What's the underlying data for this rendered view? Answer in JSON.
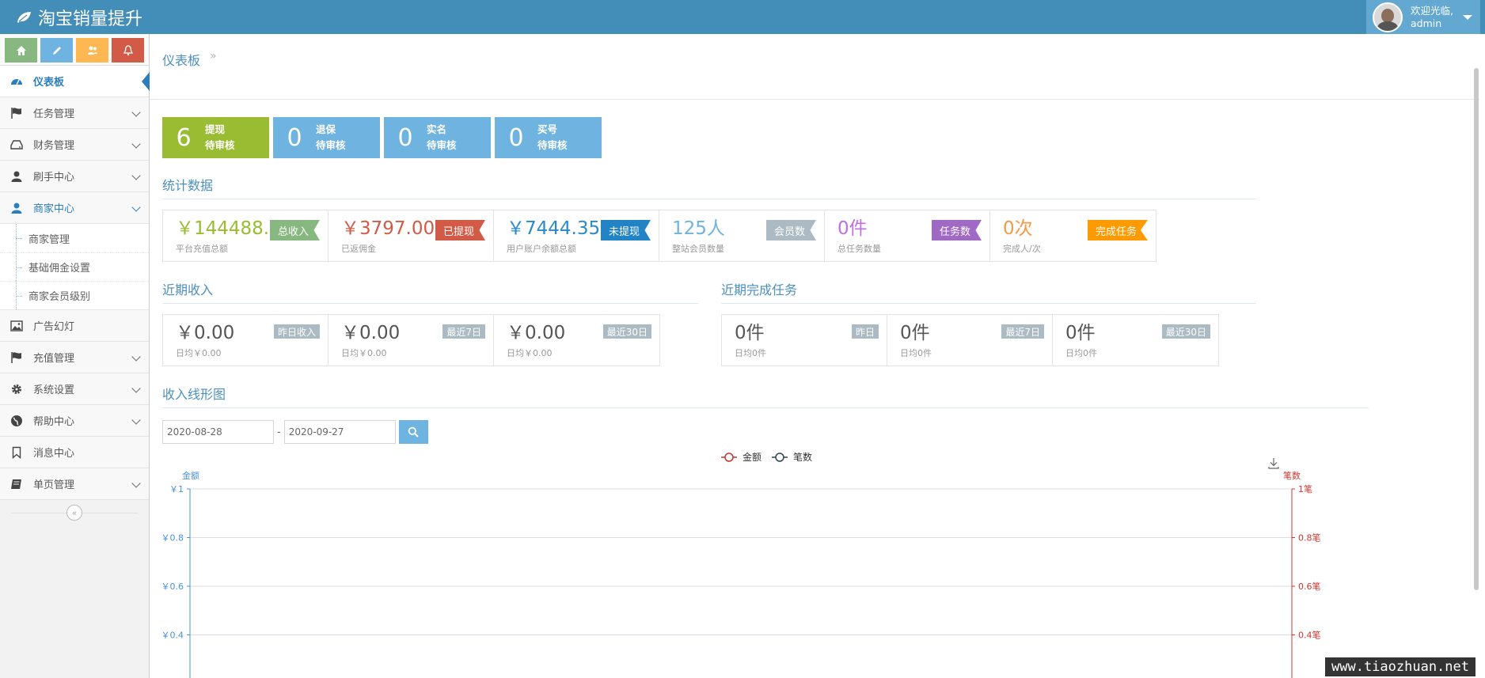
{
  "brand": {
    "title": "淘宝销量提升"
  },
  "user": {
    "welcome": "欢迎光临,",
    "name": "admin"
  },
  "shortcuts": [
    {
      "icon": "home-icon",
      "color": "#87b87f"
    },
    {
      "icon": "pencil-icon",
      "color": "#6fb3e0"
    },
    {
      "icon": "users-icon",
      "color": "#ffb752"
    },
    {
      "icon": "bell-icon",
      "color": "#d15b47"
    }
  ],
  "sidebar": {
    "items": [
      {
        "label": "仪表板",
        "icon": "dashboard-icon"
      },
      {
        "label": "任务管理",
        "icon": "flag-icon"
      },
      {
        "label": "财务管理",
        "icon": "hdd-icon"
      },
      {
        "label": "刷手中心",
        "icon": "user-icon"
      },
      {
        "label": "商家中心",
        "icon": "user-icon"
      },
      {
        "label": "广告幻灯",
        "icon": "picture-icon"
      },
      {
        "label": "充值管理",
        "icon": "flag-icon"
      },
      {
        "label": "系统设置",
        "icon": "gear-icon"
      },
      {
        "label": "帮助中心",
        "icon": "globe-icon"
      },
      {
        "label": "消息中心",
        "icon": "bookmark-icon"
      },
      {
        "label": "单页管理",
        "icon": "book-icon"
      }
    ],
    "submenu": [
      "商家管理",
      "基础佣金设置",
      "商家会员级别"
    ],
    "collapse_glyph": "«"
  },
  "breadcrumb": {
    "current": "仪表板",
    "sep": "»"
  },
  "tiles": [
    {
      "num": "6",
      "line1": "提现",
      "line2": "待审核",
      "color": "#9abc32"
    },
    {
      "num": "0",
      "line1": "退保",
      "line2": "待审核",
      "color": "#6fb3e0"
    },
    {
      "num": "0",
      "line1": "实名",
      "line2": "待审核",
      "color": "#6fb3e0"
    },
    {
      "num": "0",
      "line1": "买号",
      "line2": "待审核",
      "color": "#6fb3e0"
    }
  ],
  "sections": {
    "stats": "统计数据",
    "recent_income": "近期收入",
    "recent_tasks": "近期完成任务",
    "income_chart": "收入线形图"
  },
  "stats": [
    {
      "value": "￥144488.00",
      "sub": "平台充值总额",
      "badge": "总收入",
      "color": "#9abc32",
      "badge_color": "#87b87f"
    },
    {
      "value": "￥3797.00",
      "sub": "已返佣金",
      "badge": "已提现",
      "color": "#d15b47",
      "badge_color": "#d15b47"
    },
    {
      "value": "￥7444.35",
      "sub": "用户账户余额总额",
      "badge": "未提现",
      "color": "#2a8bcb",
      "badge_color": "#2283c5"
    },
    {
      "value": "125人",
      "sub": "整站会员数量",
      "badge": "会员数",
      "color": "#6fb3e0",
      "badge_color": "#abbac3"
    },
    {
      "value": "0件",
      "sub": "总任务数量",
      "badge": "任务数",
      "color": "#c06fdf",
      "badge_color": "#a069c3"
    },
    {
      "value": "0次",
      "sub": "完成人/次",
      "badge": "完成任务",
      "color": "#f59942",
      "badge_color": "#ff9b00"
    }
  ],
  "recent_income": [
    {
      "value": "￥0.00",
      "sub": "日均￥0.00",
      "label": "昨日收入"
    },
    {
      "value": "￥0.00",
      "sub": "日均￥0.00",
      "label": "最近7日"
    },
    {
      "value": "￥0.00",
      "sub": "日均￥0.00",
      "label": "最近30日"
    }
  ],
  "recent_tasks": [
    {
      "value": "0件",
      "sub": "日均0件",
      "label": "昨日"
    },
    {
      "value": "0件",
      "sub": "日均0件",
      "label": "最近7日"
    },
    {
      "value": "0件",
      "sub": "日均0件",
      "label": "最近30日"
    }
  ],
  "date_range": {
    "start": "2020-08-28",
    "end": "2020-09-27",
    "sep": "-"
  },
  "chart_data": {
    "type": "line",
    "legend_placement": "top-center",
    "series": [
      {
        "name": "金额",
        "color": "#c23531",
        "values": []
      },
      {
        "name": "笔数",
        "color": "#2f4554",
        "values": []
      }
    ],
    "y_left": {
      "label": "金额",
      "ticks": [
        "￥1",
        "￥0.8",
        "￥0.6",
        "￥0.4"
      ],
      "range": [
        0,
        1
      ],
      "color": "#4a90e2"
    },
    "y_right": {
      "label": "笔数",
      "ticks": [
        "1笔",
        "0.8笔",
        "0.6笔",
        "0.4笔"
      ],
      "range": [
        0,
        1
      ],
      "color": "#d0352f"
    },
    "grid": true
  },
  "watermark": "www.tiaozhuan.net"
}
